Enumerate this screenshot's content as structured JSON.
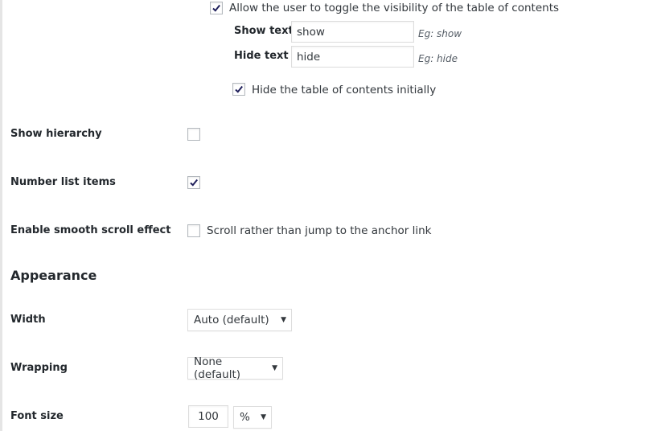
{
  "colors": {
    "accent": "#1e1e5a",
    "border": "#dddddd",
    "text": "#23282d"
  },
  "visibility": {
    "toggle_checkbox": {
      "label": "Allow the user to toggle the visibility of the table of contents",
      "checked": true
    },
    "show_text": {
      "label": "Show text",
      "value": "show",
      "hint": "Eg: show"
    },
    "hide_text": {
      "label": "Hide text",
      "value": "hide",
      "hint": "Eg: hide"
    },
    "hide_initially": {
      "label": "Hide the table of contents initially",
      "checked": true
    }
  },
  "settings": {
    "show_hierarchy": {
      "label": "Show hierarchy",
      "checked": false
    },
    "number_list_items": {
      "label": "Number list items",
      "checked": true
    },
    "smooth_scroll": {
      "label": "Enable smooth scroll effect",
      "checked": false,
      "description": "Scroll rather than jump to the anchor link"
    }
  },
  "appearance": {
    "title": "Appearance",
    "width": {
      "label": "Width",
      "selected": "Auto (default)"
    },
    "wrapping": {
      "label": "Wrapping",
      "selected": "None (default)"
    },
    "font_size": {
      "label": "Font size",
      "value": "100",
      "unit": "%"
    }
  },
  "icons": {
    "check": "check-icon",
    "dropdown": "caret-down-icon"
  }
}
